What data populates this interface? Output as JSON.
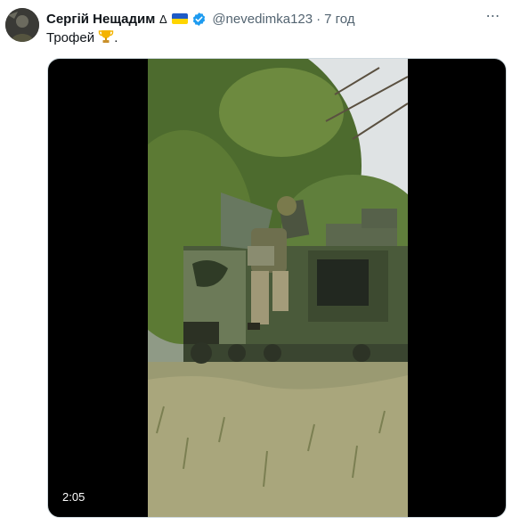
{
  "tweet": {
    "author_name": "Сергій Нещадим",
    "name_symbol": "∆",
    "handle": "@nevedimka123",
    "separator": "·",
    "time": "7 год",
    "text": "Трофей",
    "text_suffix": ".",
    "more_icon": "⋯"
  },
  "video": {
    "duration": "2:05"
  },
  "colors": {
    "verified": "#1d9bf0",
    "flag_blue": "#1e5bc6",
    "flag_yellow": "#ffd500",
    "secondary_text": "#536471"
  }
}
